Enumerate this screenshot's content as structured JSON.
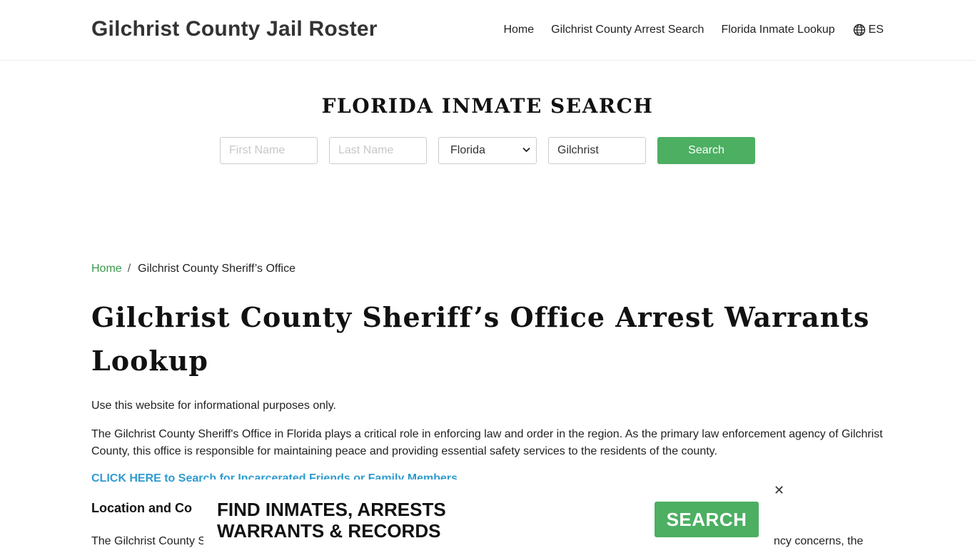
{
  "header": {
    "brand": "Gilchrist County Jail Roster",
    "nav": [
      {
        "label": "Home"
      },
      {
        "label": "Gilchrist County Arrest Search"
      },
      {
        "label": "Florida Inmate Lookup"
      }
    ],
    "language": {
      "label": "ES",
      "icon": "globe-icon"
    }
  },
  "search": {
    "title": "FLORIDA INMATE SEARCH",
    "first_name_placeholder": "First Name",
    "last_name_placeholder": "Last Name",
    "state_value": "Florida",
    "county_value": "Gilchrist",
    "button_label": "Search"
  },
  "breadcrumb": {
    "home": "Home",
    "separator": "/",
    "current": "Gilchrist County Sheriff’s Office"
  },
  "main": {
    "title": "Gilchrist County Sheriff’s Office Arrest Warrants Lookup",
    "disclaimer": "Use this website for informational purposes only.",
    "intro": "The Gilchrist County Sheriff's Office in Florida plays a critical role in enforcing law and order in the region. As the primary law enforcement agency of Gilchrist County, this office is responsible for maintaining peace and providing essential safety services to the residents of the county.",
    "cta_link": "CLICK HERE to Search for Incarcerated Friends or Family Members",
    "section_heading_visible": "Location and Co",
    "para_cut_left": "The Gilchrist County S",
    "para_cut_right": "ncy concerns, the"
  },
  "ad": {
    "text_line1": "FIND INMATES, ARRESTS",
    "text_line2": "WARRANTS & RECORDS",
    "button_label": "SEARCH",
    "close_label": "✕"
  },
  "colors": {
    "accent_green": "#4caf62",
    "link_blue": "#2e9bcf",
    "breadcrumb_green": "#3a9a4e"
  }
}
